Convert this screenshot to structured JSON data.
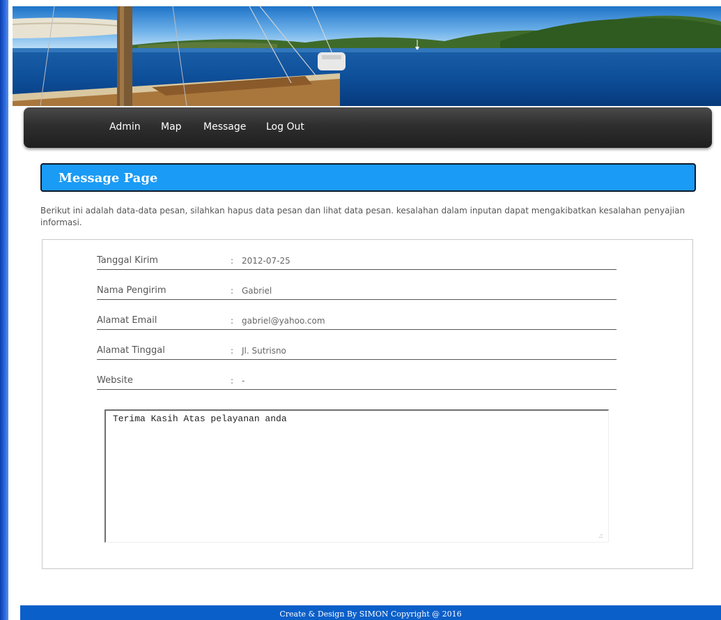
{
  "nav": {
    "items": [
      {
        "label": "Admin"
      },
      {
        "label": "Map"
      },
      {
        "label": "Message"
      },
      {
        "label": "Log Out"
      }
    ]
  },
  "page": {
    "title": "Message Page",
    "intro": "Berikut ini adalah data-data pesan, silahkan hapus data pesan dan lihat data pesan. kesalahan dalam inputan dapat mengakibatkan kesalahan penyajian informasi."
  },
  "detail": {
    "separator": ":",
    "rows": [
      {
        "label": "Tanggal Kirim",
        "value": "2012-07-25"
      },
      {
        "label": "Nama Pengirim",
        "value": "Gabriel"
      },
      {
        "label": "Alamat Email",
        "value": "gabriel@yahoo.com"
      },
      {
        "label": "Alamat Tinggal",
        "value": "Jl. Sutrisno"
      },
      {
        "label": "Website",
        "value": "-"
      }
    ],
    "message": "Terima Kasih Atas pelayanan anda"
  },
  "footer": {
    "text": "Create & Design By SIMON Copyright @ 2016"
  },
  "colors": {
    "title_bar": "#1a9bf5",
    "nav_bg": "#2e2e2e",
    "footer_bg": "#0b5fc9",
    "left_bar": "#2c6be0"
  }
}
